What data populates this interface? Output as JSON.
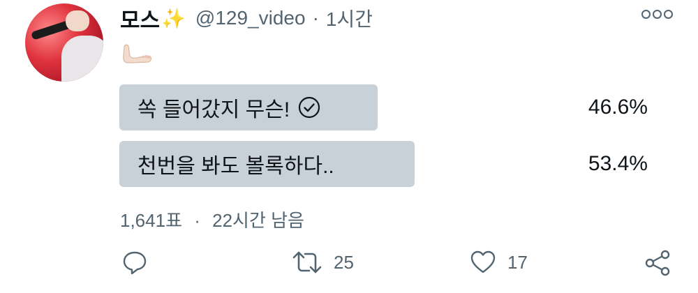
{
  "tweet": {
    "author_name": "모스",
    "name_emoji": "sparkles-icon",
    "handle": "@129_video",
    "separator": "·",
    "time": "1시간",
    "body_emoji": "foot-icon"
  },
  "poll": {
    "options": [
      {
        "label": "쏙 들어갔지 무슨!",
        "percent": 46.6,
        "percent_text": "46.6%",
        "selected": true
      },
      {
        "label": "천번을 봐도 볼록하다..",
        "percent": 53.4,
        "percent_text": "53.4%",
        "selected": false
      }
    ],
    "votes": "1,641표",
    "separator": "·",
    "time_left": "22시간 남음"
  },
  "actions": {
    "reply_count": "",
    "retweet_count": "25",
    "like_count": "17"
  },
  "colors": {
    "bar": "#c9d1d8",
    "secondary_text": "#536471",
    "avatar_bg": "#e0343f"
  }
}
